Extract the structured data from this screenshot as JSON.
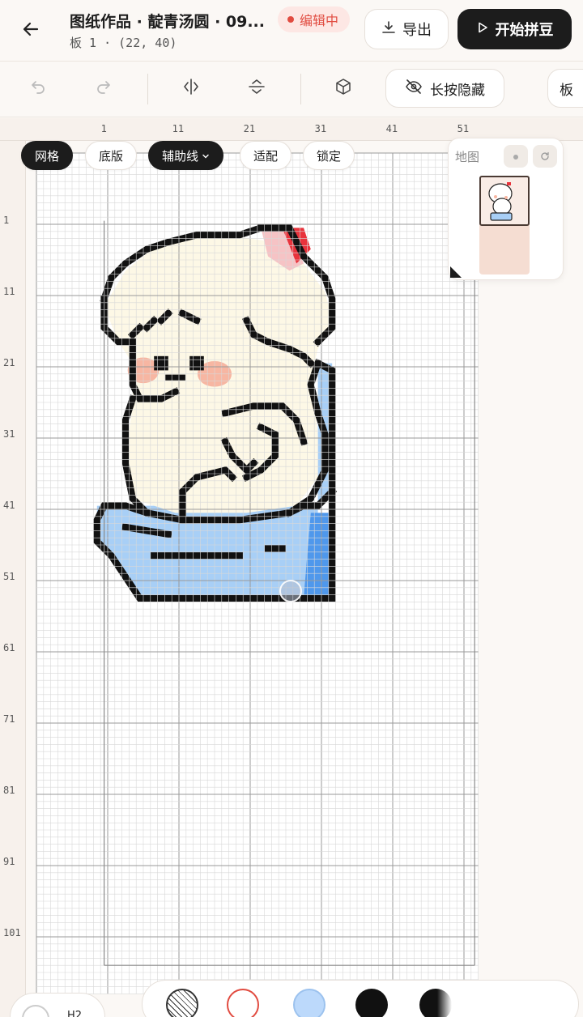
{
  "header": {
    "title": "图纸作品 · 靛青汤圆 · 09...",
    "subtitle": "板 1 · (22, 40)",
    "status_badge": "编辑中",
    "export_label": "导出",
    "start_label": "开始拼豆"
  },
  "toolbar": {
    "icons": [
      "undo-icon",
      "redo-icon",
      "flip-horizontal-icon",
      "flip-vertical-icon",
      "cube-icon"
    ],
    "hide_label": "长按隐藏",
    "board_label": "板"
  },
  "canvas": {
    "ruler_top": [
      "1",
      "11",
      "21",
      "31",
      "41",
      "51"
    ],
    "ruler_left": [
      "1",
      "11",
      "21",
      "31",
      "41",
      "51",
      "61",
      "71",
      "81",
      "91",
      "101"
    ],
    "chips": [
      {
        "label": "网格",
        "active": true
      },
      {
        "label": "底版",
        "active": false
      },
      {
        "label": "辅助线",
        "active": true
      },
      {
        "label": "适配",
        "active": false
      },
      {
        "label": "锁定",
        "active": false
      }
    ],
    "minimap": {
      "title": "地图"
    },
    "colors": {
      "outline": "#111111",
      "cream": "#fdf8e6",
      "blue": "#a8cff6",
      "blue_dark": "#4f98ec",
      "blush": "#f7b6a2",
      "red": "#e8333c",
      "pink": "#f6c3c5"
    }
  },
  "palette": {
    "left_label": "H2",
    "swatch_colors": [
      "#ffffff",
      "#ffffff",
      "#bcd9fb",
      "#111111",
      "#111111"
    ]
  }
}
